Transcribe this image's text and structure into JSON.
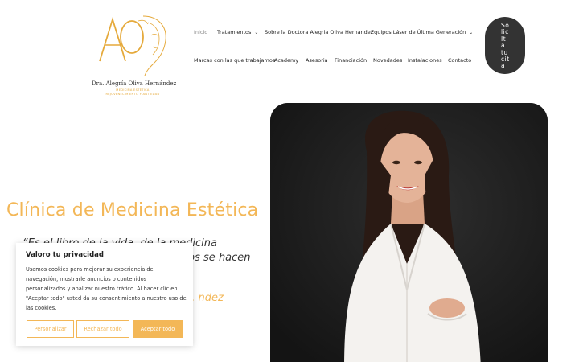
{
  "logo": {
    "monogram": "AO",
    "name": "Dra. Alegría Oliva Hernández",
    "subtitle_line1": "MEDICINA ESTÉTICA",
    "subtitle_line2": "REJUVENECIMIENTO Y ANTIEDAD"
  },
  "nav": {
    "inicio": "Inicio",
    "tratamientos": "Tratamientos",
    "sobre": "Sobre la Doctora Alegria Oliva Hernandez",
    "equipos": "Equipos Láser de Última Generación",
    "marcas": "Marcas con las que trabajamos",
    "academy": "Academy",
    "asesoria": "Asesoria",
    "financiacion": "Financiación",
    "novedades": "Novedades",
    "instalaciones": "Instalaciones",
    "contacto": "Contacto",
    "chevron": "⌄"
  },
  "cta": {
    "label": "So\nlic\nIt\na\ntu\ncit\na"
  },
  "hero": {
    "title": "Clínica de Medicina Estética",
    "quote_line1": "“Es el libro de la vida, de la medicina",
    "quote_line2": "... cuando los sueños se hacen",
    "author": "... ndez"
  },
  "cookie": {
    "title": "Valoro tu privacidad",
    "text": "Usamos cookies para mejorar su experiencia de navegación, mostrarle anuncios o contenidos personalizados y analizar nuestro tráfico. Al hacer clic en \"Aceptar todo\" usted da su consentimiento a nuestro uso de las cookies.",
    "personalizar": "Personalizar",
    "rechazar": "Rechazar todo",
    "aceptar": "Aceptar todo"
  },
  "colors": {
    "accent": "#f3b757",
    "dark": "#333333"
  }
}
